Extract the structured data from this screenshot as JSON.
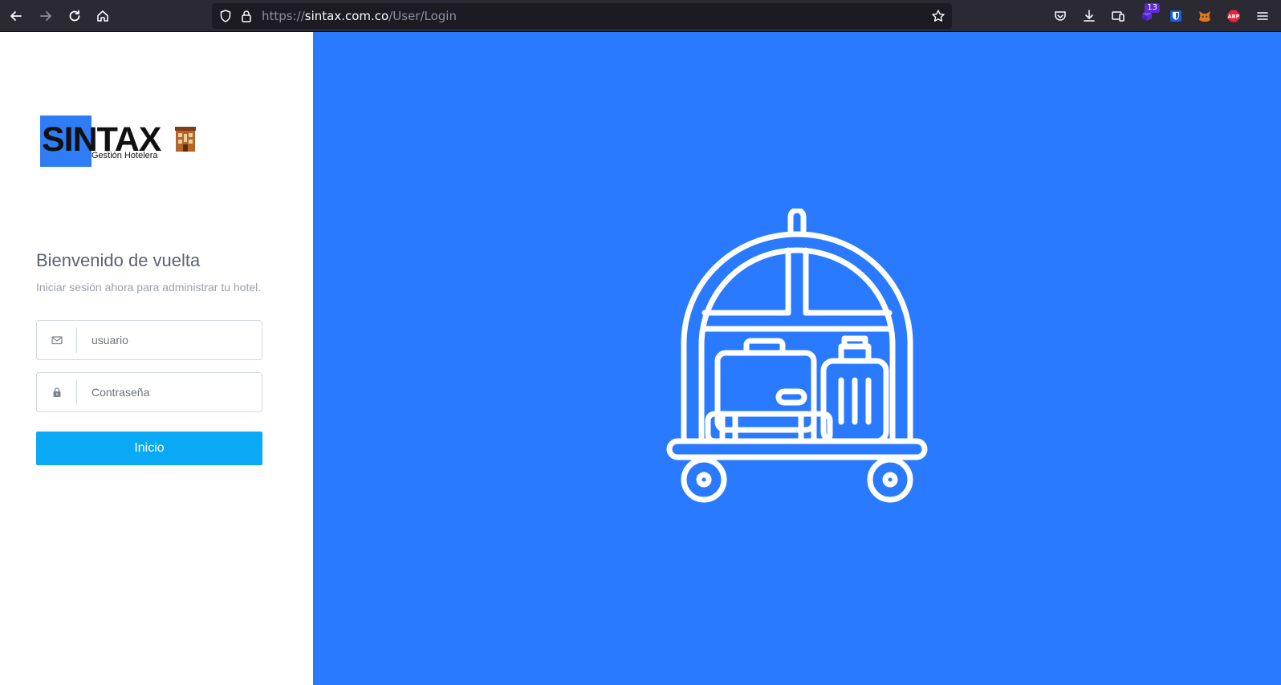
{
  "browser": {
    "url_scheme": "https://",
    "url_host": "sintax.com.co",
    "url_path": "/User/Login",
    "extension_badge": "13",
    "abp_label": "ABP"
  },
  "logo": {
    "name": "SINTAX",
    "tagline": "Gestión Hotelera"
  },
  "login": {
    "title": "Bienvenido de vuelta",
    "subtitle": "Iniciar sesión ahora para administrar tu hotel.",
    "username_placeholder": "usuario",
    "password_placeholder": "Contraseña",
    "submit_label": "Inicio"
  },
  "colors": {
    "panel_blue": "#2a7aff",
    "button": "#0aa9f5",
    "logo_square": "#2f7cf6"
  }
}
